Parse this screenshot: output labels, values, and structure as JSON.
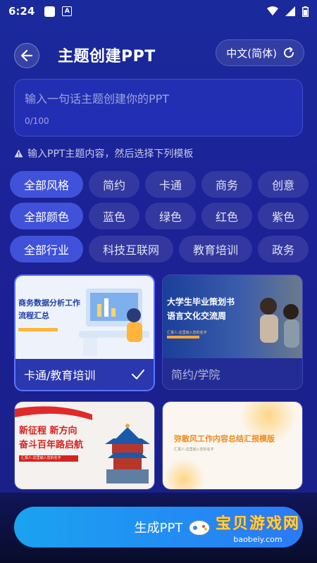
{
  "status": {
    "time": "6:24"
  },
  "header": {
    "title": "主题创建PPT",
    "language": "中文(简体)"
  },
  "topic_input": {
    "placeholder": "输入一句话主题创建你的PPT",
    "counter": "0/100"
  },
  "hint": "输入PPT主题内容，然后选择下列模板",
  "filters": {
    "style": [
      "全部风格",
      "简约",
      "卡通",
      "商务",
      "创意"
    ],
    "color": [
      "全部颜色",
      "蓝色",
      "绿色",
      "红色",
      "紫色"
    ],
    "industry": [
      "全部行业",
      "科技互联网",
      "教育培训",
      "政务"
    ]
  },
  "templates": [
    {
      "label": "卡通/教育培训",
      "selected": true,
      "title_lines": [
        "商务数据分析工作",
        "流程汇总"
      ]
    },
    {
      "label": "简约/学院",
      "selected": false,
      "title_lines": [
        "大学生毕业策划书",
        "语言文化交流周"
      ],
      "subtitle": "汇报人:这里输入您的名字"
    },
    {
      "label": "",
      "selected": false,
      "title_lines": [
        "新征程 新方向",
        "奋斗百年路启航"
      ],
      "subtitle": "汇报人:这里输入您的名字"
    },
    {
      "label": "",
      "selected": false,
      "title_lines": [
        "弥散风工作内容总结汇报模版"
      ],
      "subtitle": "汇报人:这里输入您的名字"
    }
  ],
  "generate_button": "生成PPT",
  "watermark": {
    "name": "宝贝游戏网",
    "url": "baobeiy.com"
  },
  "colors": {
    "accent": "#2a7af6",
    "selected_border": "#5b74ff",
    "background": "#1c2196"
  }
}
